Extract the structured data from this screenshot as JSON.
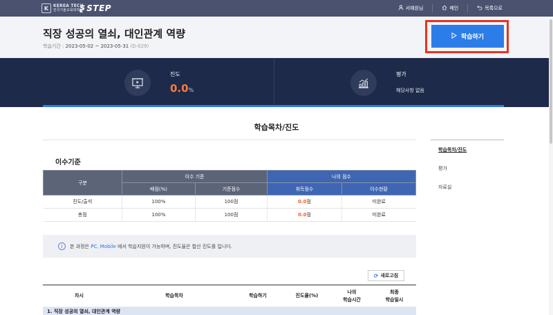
{
  "topbar": {
    "logo_main": "KEREA TECH",
    "logo_sub": "한국기술교육대학교",
    "logo_step": "STEP",
    "links": [
      {
        "icon": "user-icon",
        "label": "서혜원님"
      },
      {
        "icon": "home-icon",
        "label": "메인"
      },
      {
        "icon": "undo-icon",
        "label": "목록으로"
      }
    ]
  },
  "course": {
    "title": "직장 성공의 열쇠, 대인관계 역량",
    "period_label": "학습기간 :",
    "period": "2023-05-02 ~ 2023-05-31",
    "dday": "(D-029)",
    "study_button": "학습하기"
  },
  "stats": {
    "progress_label": "진도",
    "progress_value": "0.0",
    "progress_unit": "%",
    "eval_label": "평가",
    "eval_value": "해당사항 없음"
  },
  "section_title": "학습목차/진도",
  "sidebar": {
    "items": [
      "학습목차/진도",
      "평가",
      "자료실"
    ]
  },
  "criteria": {
    "title": "이수기준",
    "headers": {
      "category": "구분",
      "group_criteria": "이수 기준",
      "group_mine": "나의 점수",
      "weight": "배점(%)",
      "base": "기준점수",
      "score": "취득점수",
      "status": "이수현황"
    },
    "rows": [
      {
        "name": "진도/출석",
        "weight": "100%",
        "base": "100점",
        "score": "0.0",
        "score_unit": "점",
        "status": "미완료"
      },
      {
        "name": "총점",
        "weight": "100%",
        "base": "100점",
        "score": "0.0",
        "score_unit": "점",
        "status": "미완료"
      }
    ]
  },
  "notice": {
    "prefix": "본 과정은",
    "devices": "PC, Mobile",
    "suffix": "에서 학습지원이 가능하며, 진도율은 합산 진도를 입니다."
  },
  "refresh_label": "새로고침",
  "progress_table": {
    "headers": [
      "차시",
      "학습목차",
      "학습하기",
      "진도율(%)",
      "나의\n학습시간",
      "최종\n학습일시"
    ],
    "first_row": "1. 직장 성공의 열쇠, 대인관계 역량"
  },
  "colors": {
    "nav_bg": "#4a5270",
    "stats_bg": "#1d2a4a",
    "accent_blue": "#2d7de8",
    "highlight_red": "#e8321e",
    "value_orange": "#ff7a3a"
  }
}
